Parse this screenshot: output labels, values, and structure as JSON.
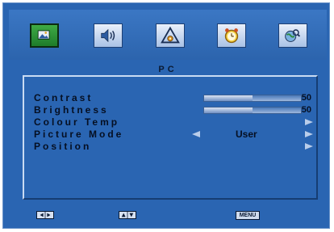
{
  "menu": {
    "tabs": [
      {
        "name": "picture",
        "active": true
      },
      {
        "name": "sound",
        "active": false
      },
      {
        "name": "setup",
        "active": false
      },
      {
        "name": "timer",
        "active": false
      },
      {
        "name": "option",
        "active": false
      }
    ],
    "title": "PC"
  },
  "settings": {
    "contrast": {
      "label": "Contrast",
      "value": "50",
      "level": 0.5
    },
    "brightness": {
      "label": "Brightness",
      "value": "50",
      "level": 0.5
    },
    "colour_temp": {
      "label": "Colour Temp"
    },
    "picture_mode": {
      "label": "Picture Mode",
      "value": "User"
    },
    "position": {
      "label": "Position"
    }
  },
  "help": {
    "menu_label": "MENU"
  },
  "colors": {
    "background": "#2a65b2",
    "active_tab": "#2e9a3a",
    "text": "#050f22"
  }
}
